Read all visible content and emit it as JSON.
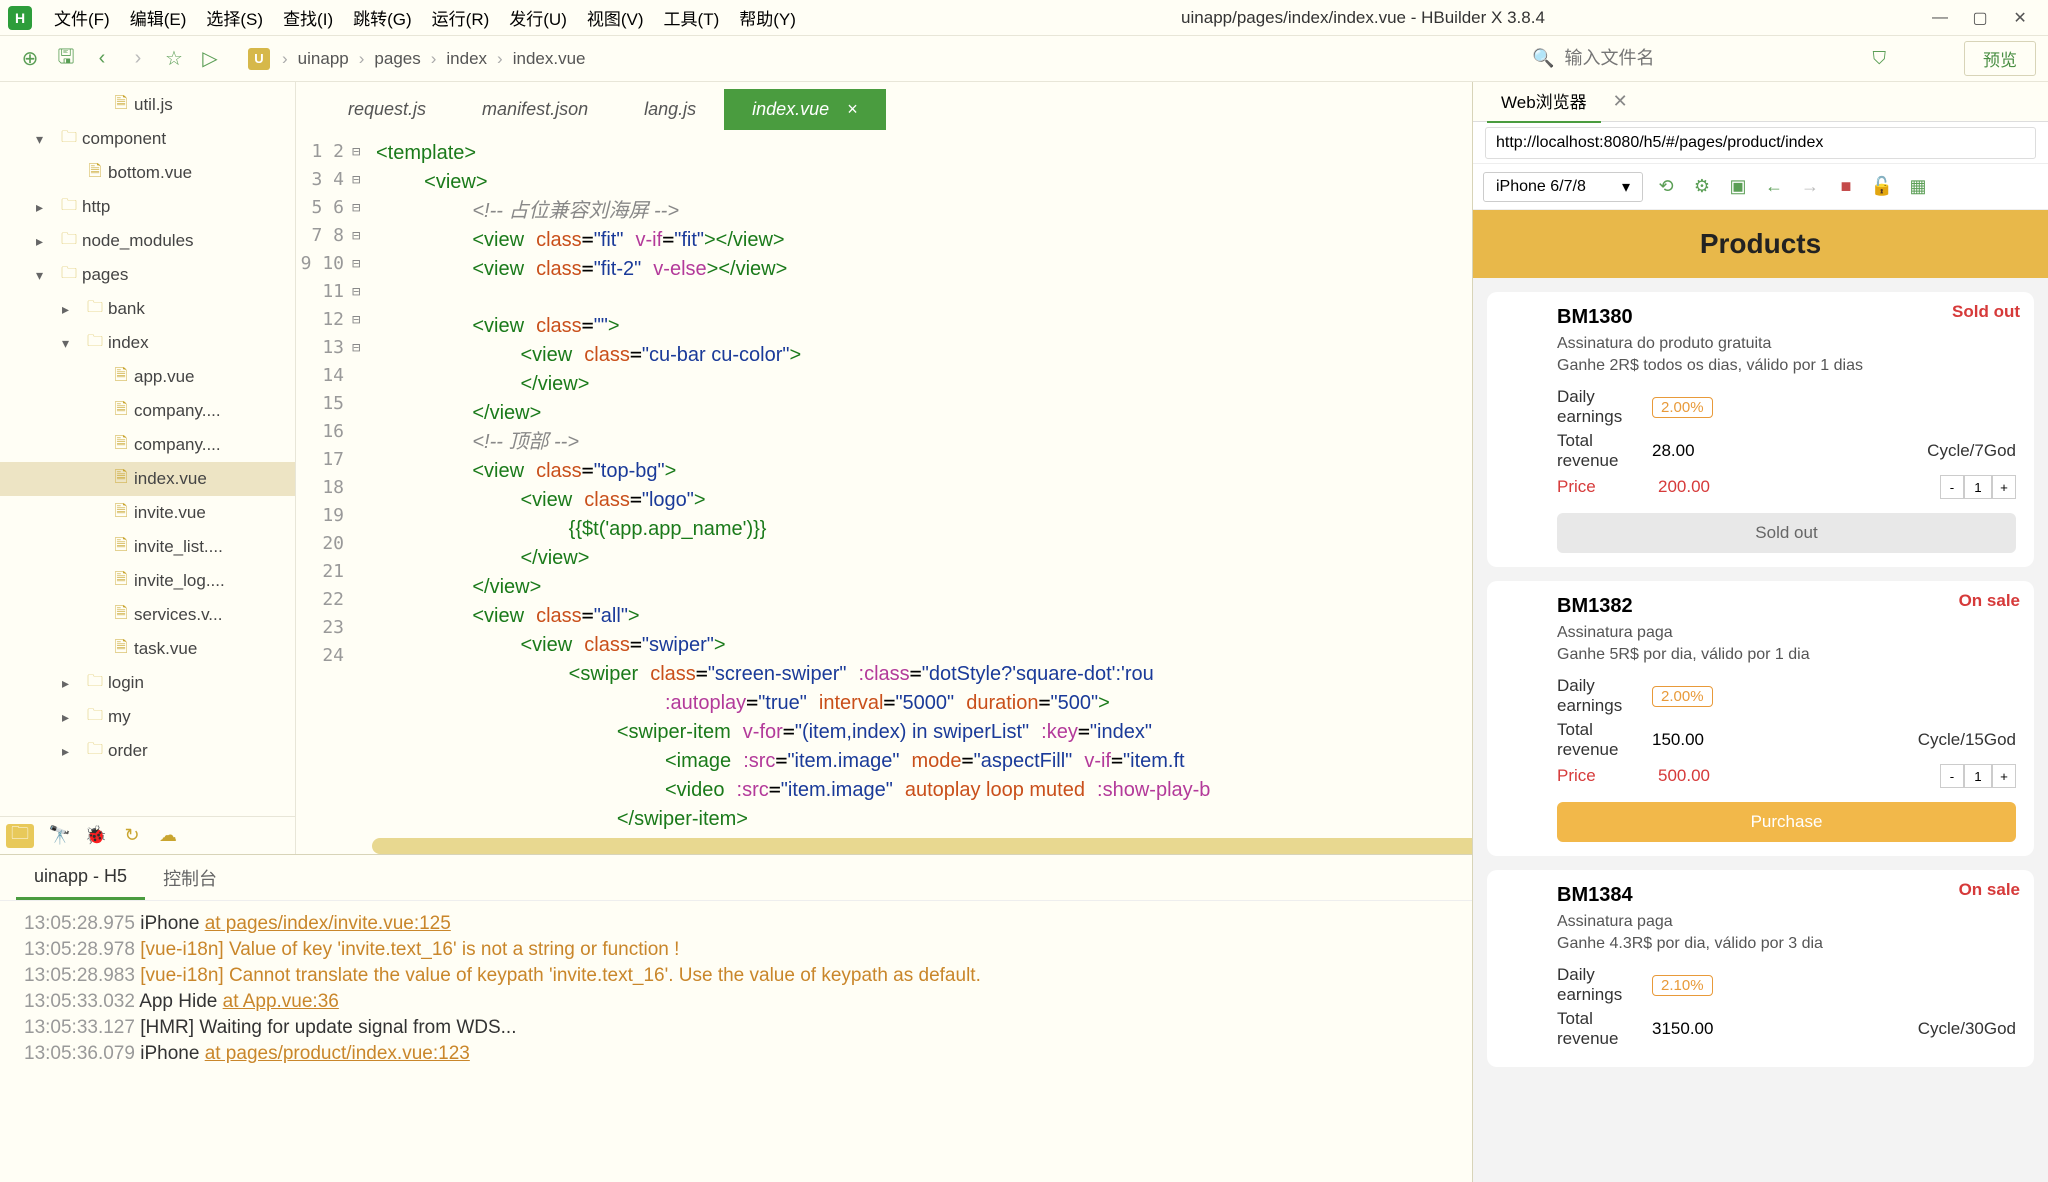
{
  "window_title": "uinapp/pages/index/index.vue - HBuilder X 3.8.4",
  "menu": [
    "文件(F)",
    "编辑(E)",
    "选择(S)",
    "查找(I)",
    "跳转(G)",
    "运行(R)",
    "发行(U)",
    "视图(V)",
    "工具(T)",
    "帮助(Y)"
  ],
  "breadcrumb": [
    "uinapp",
    "pages",
    "index",
    "index.vue"
  ],
  "search_placeholder": "输入文件名",
  "preview_btn": "预览",
  "tree": [
    {
      "label": "util.js",
      "type": "file",
      "indent": 3,
      "arrow": "none"
    },
    {
      "label": "component",
      "type": "folder",
      "indent": 1,
      "arrow": "down"
    },
    {
      "label": "bottom.vue",
      "type": "file",
      "indent": 2,
      "arrow": "none"
    },
    {
      "label": "http",
      "type": "folder",
      "indent": 1,
      "arrow": "right"
    },
    {
      "label": "node_modules",
      "type": "folder",
      "indent": 1,
      "arrow": "right"
    },
    {
      "label": "pages",
      "type": "folder",
      "indent": 1,
      "arrow": "down"
    },
    {
      "label": "bank",
      "type": "folder",
      "indent": 2,
      "arrow": "right"
    },
    {
      "label": "index",
      "type": "folder",
      "indent": 2,
      "arrow": "down"
    },
    {
      "label": "app.vue",
      "type": "file",
      "indent": 3,
      "arrow": "none"
    },
    {
      "label": "company....",
      "type": "file",
      "indent": 3,
      "arrow": "none"
    },
    {
      "label": "company....",
      "type": "file",
      "indent": 3,
      "arrow": "none"
    },
    {
      "label": "index.vue",
      "type": "file",
      "indent": 3,
      "arrow": "none",
      "active": true
    },
    {
      "label": "invite.vue",
      "type": "file",
      "indent": 3,
      "arrow": "none"
    },
    {
      "label": "invite_list....",
      "type": "file",
      "indent": 3,
      "arrow": "none"
    },
    {
      "label": "invite_log....",
      "type": "file",
      "indent": 3,
      "arrow": "none"
    },
    {
      "label": "services.v...",
      "type": "file",
      "indent": 3,
      "arrow": "none"
    },
    {
      "label": "task.vue",
      "type": "file",
      "indent": 3,
      "arrow": "none"
    },
    {
      "label": "login",
      "type": "folder",
      "indent": 2,
      "arrow": "right"
    },
    {
      "label": "my",
      "type": "folder",
      "indent": 2,
      "arrow": "right"
    },
    {
      "label": "order",
      "type": "folder",
      "indent": 2,
      "arrow": "right"
    }
  ],
  "tabs": [
    {
      "label": "request.js"
    },
    {
      "label": "manifest.json"
    },
    {
      "label": "lang.js"
    },
    {
      "label": "index.vue",
      "active": true
    }
  ],
  "code_comment_1": "占位兼容刘海屏",
  "code_comment_2": "顶部",
  "code_mustache": "{{$t('app.app_name')}}",
  "console_tabs": {
    "active": "uinapp - H5",
    "other": "控制台"
  },
  "console_lines": [
    {
      "ts": "13:05:28.975",
      "msg": "iPhone",
      "link": "at pages/index/invite.vue:125"
    },
    {
      "ts": "13:05:28.978",
      "warn": "[vue-i18n] Value of key 'invite.text_16' is not a string or function !"
    },
    {
      "ts": "13:05:28.983",
      "warn": "[vue-i18n] Cannot translate the value of keypath 'invite.text_16'. Use the value of keypath as default."
    },
    {
      "ts": "13:05:33.032",
      "msg": "App Hide",
      "link": "at App.vue:36"
    },
    {
      "ts": "13:05:33.127",
      "msg": "[HMR] Waiting for update signal from WDS..."
    },
    {
      "ts": "13:05:36.079",
      "msg": "iPhone",
      "link": "at pages/product/index.vue:123"
    }
  ],
  "preview": {
    "tab_label": "Web浏览器",
    "url": "http://localhost:8080/h5/#/pages/product/index",
    "device": "iPhone 6/7/8",
    "page_title": "Products",
    "products": [
      {
        "badge": "Sold out",
        "name": "BM1380",
        "sub1": "Assinatura do produto gratuita",
        "sub2": "Ganhe 2R$ todos os dias, válido por 1 dias",
        "pct": "2.00%",
        "total": "28.00",
        "cycle": "Cycle/7God",
        "price": "200.00",
        "qty": "1",
        "action": "Sold out",
        "action_style": "soldout"
      },
      {
        "badge": "On sale",
        "name": "BM1382",
        "sub1": "Assinatura paga",
        "sub2": "Ganhe 5R$ por dia, válido por 1 dia",
        "pct": "2.00%",
        "total": "150.00",
        "cycle": "Cycle/15God",
        "price": "500.00",
        "qty": "1",
        "action": "Purchase",
        "action_style": "purchase"
      },
      {
        "badge": "On sale",
        "name": "BM1384",
        "sub1": "Assinatura paga",
        "sub2": "Ganhe 4.3R$ por dia, válido por 3 dia",
        "pct": "2.10%",
        "total": "3150.00",
        "cycle": "Cycle/30God",
        "price": "",
        "qty": "",
        "action": "",
        "action_style": ""
      }
    ],
    "labels": {
      "daily": "Daily earnings",
      "total": "Total revenue",
      "price": "Price"
    }
  }
}
